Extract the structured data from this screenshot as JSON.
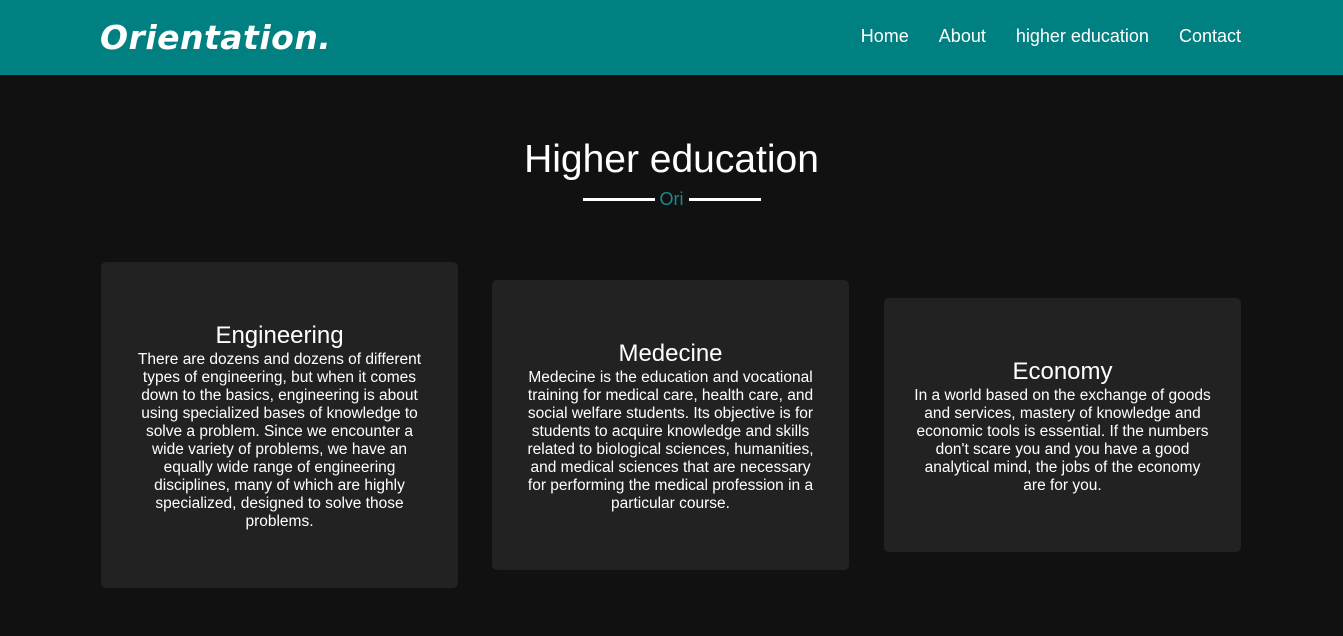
{
  "header": {
    "logo": "Orientation.",
    "nav": [
      {
        "label": "Home"
      },
      {
        "label": "About"
      },
      {
        "label": "higher education"
      },
      {
        "label": "Contact"
      }
    ]
  },
  "section": {
    "title": "Higher education",
    "subtitle": "Ori"
  },
  "cards": [
    {
      "title": "Engineering",
      "text": "There are dozens and dozens of different types of engineering, but when it comes down to the basics, engineering is about using specialized bases of knowledge to solve a problem. Since we encounter a wide variety of problems, we have an equally wide range of engineering disciplines, many of which are highly specialized, designed to solve those problems."
    },
    {
      "title": "Medecine",
      "text": "Medecine is the education and vocational training for medical care, health care, and social welfare students. Its objective is for students to acquire knowledge and skills related to biological sciences, humanities, and medical sciences that are necessary for performing the medical profession in a particular course."
    },
    {
      "title": "Economy",
      "text": "In a world based on the exchange of goods and services, mastery of knowledge and economic tools is essential. If the numbers don't scare you and you have a good analytical mind, the jobs of the economy are for you."
    }
  ],
  "colors": {
    "header_bg": "#008080",
    "page_bg": "#111111",
    "card_bg": "#222222",
    "accent": "#1a8a8a"
  }
}
